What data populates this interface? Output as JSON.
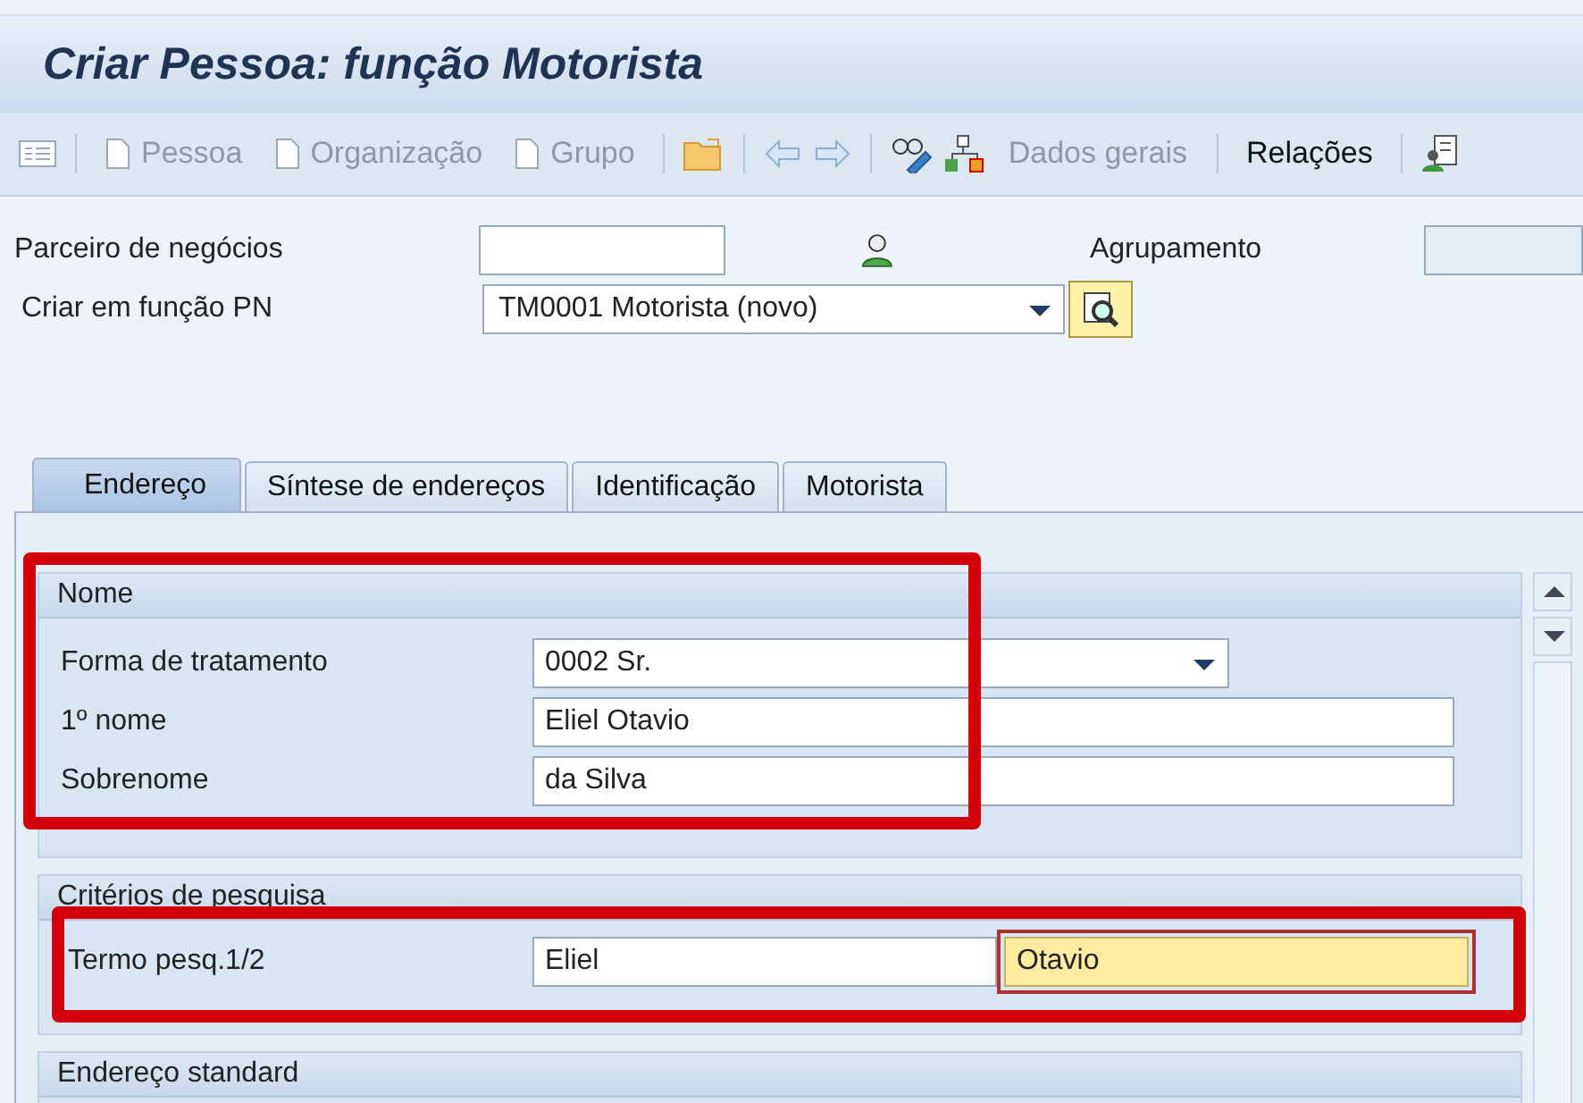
{
  "window": {
    "title": "Criar Pessoa: função Motorista"
  },
  "toolbar": [
    {
      "label": "Pessoa",
      "disabled": true
    },
    {
      "label": "Organização",
      "disabled": true
    },
    {
      "label": "Grupo",
      "disabled": true
    },
    {
      "label": "Dados gerais",
      "disabled": true
    },
    {
      "label": "Relações",
      "disabled": false
    }
  ],
  "header": {
    "partner_label": "Parceiro de negócios",
    "grouping_label": "Agrupamento",
    "role_label": "Criar em função PN",
    "role_value": "TM0001 Motorista (novo)"
  },
  "tabs": [
    {
      "label": "Endereço",
      "selected": true
    },
    {
      "label": "Síntese de endereços",
      "selected": false
    },
    {
      "label": "Identificação",
      "selected": false
    },
    {
      "label": "Motorista",
      "selected": false
    }
  ],
  "sections": [
    {
      "title": "Nome",
      "rows": [
        {
          "label": "Forma de tratamento",
          "fields": [
            {
              "kind": "dropdown",
              "value": "0002 Sr.",
              "focused": false
            }
          ]
        },
        {
          "label": "1º nome",
          "fields": [
            {
              "kind": "text",
              "value": "Eliel Otavio",
              "focused": false
            }
          ]
        },
        {
          "label": "Sobrenome",
          "fields": [
            {
              "kind": "text",
              "value": "da Silva",
              "focused": false
            }
          ]
        }
      ]
    },
    {
      "title": "Critérios de pesquisa",
      "rows": [
        {
          "label": "Termo pesq.1/2",
          "fields": [
            {
              "kind": "half",
              "value": "Eliel",
              "focused": false
            },
            {
              "kind": "half",
              "value": "Otavio",
              "focused": true
            }
          ]
        }
      ]
    },
    {
      "title": "Endereço standard"
    }
  ]
}
